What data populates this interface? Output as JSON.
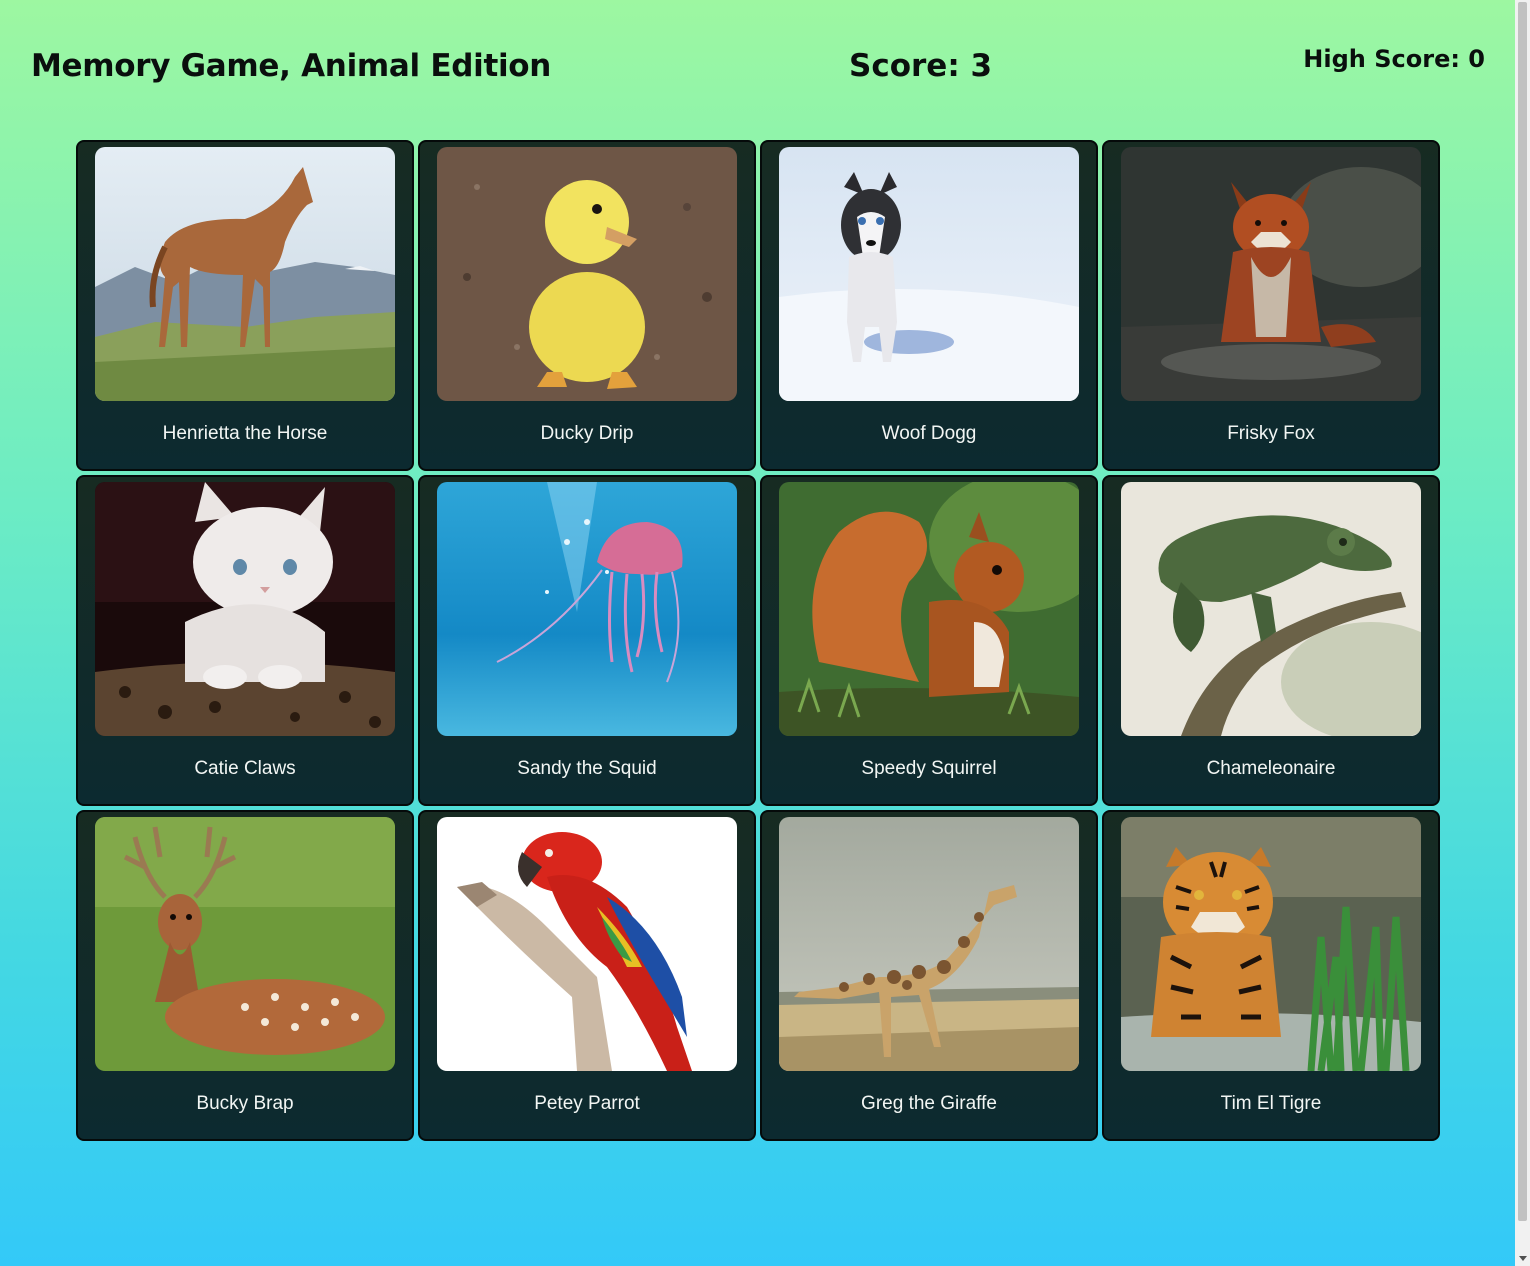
{
  "header": {
    "title": "Memory Game, Animal Edition",
    "score": "Score: 3",
    "high_score": "High Score: 0"
  },
  "cards": [
    {
      "label": "Henrietta the Horse",
      "image": "horse-photo"
    },
    {
      "label": "Ducky Drip",
      "image": "duckling-photo"
    },
    {
      "label": "Woof Dogg",
      "image": "husky-photo"
    },
    {
      "label": "Frisky Fox",
      "image": "fox-photo"
    },
    {
      "label": "Catie Claws",
      "image": "kitten-photo"
    },
    {
      "label": "Sandy the Squid",
      "image": "jellyfish-photo"
    },
    {
      "label": "Speedy Squirrel",
      "image": "squirrel-photo"
    },
    {
      "label": "Chameleonaire",
      "image": "chameleon-photo"
    },
    {
      "label": "Bucky Brap",
      "image": "deer-photo"
    },
    {
      "label": "Petey Parrot",
      "image": "parrot-photo"
    },
    {
      "label": "Greg the Giraffe",
      "image": "giraffe-photo"
    },
    {
      "label": "Tim El Tigre",
      "image": "tiger-photo"
    }
  ],
  "colors": {
    "background_top": "#9df7a1",
    "background_bottom": "#33c9f8",
    "card_background": "#12292a",
    "card_text": "#f2f6f4"
  }
}
